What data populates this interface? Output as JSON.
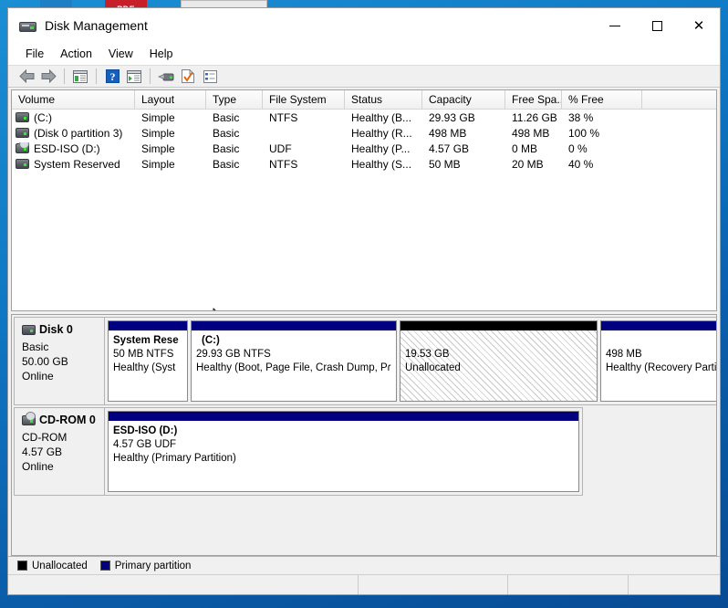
{
  "window": {
    "title": "Disk Management",
    "icon": "disk-drive-icon",
    "controls": {
      "minimize": "—",
      "maximize": "□",
      "close": "✕"
    }
  },
  "menubar": {
    "items": [
      {
        "label": "File"
      },
      {
        "label": "Action"
      },
      {
        "label": "View"
      },
      {
        "label": "Help"
      }
    ]
  },
  "toolbar": {
    "buttons": [
      {
        "name": "back-icon",
        "tip": "Back"
      },
      {
        "name": "forward-icon",
        "tip": "Forward"
      },
      {
        "name": "show-console-tree-icon",
        "tip": "Show/Hide Console Tree"
      },
      {
        "name": "help-icon",
        "tip": "Help"
      },
      {
        "name": "show-action-pane-icon",
        "tip": "Show/Hide Action Pane"
      },
      {
        "name": "rescan-disks-icon",
        "tip": "Rescan Disks"
      },
      {
        "name": "properties-icon",
        "tip": "Properties"
      },
      {
        "name": "list-view-icon",
        "tip": "List View"
      }
    ]
  },
  "volume_list": {
    "columns": [
      {
        "key": "volume",
        "label": "Volume"
      },
      {
        "key": "layout",
        "label": "Layout"
      },
      {
        "key": "type",
        "label": "Type"
      },
      {
        "key": "file_system",
        "label": "File System"
      },
      {
        "key": "status",
        "label": "Status"
      },
      {
        "key": "capacity",
        "label": "Capacity"
      },
      {
        "key": "free_space",
        "label": "Free Spa..."
      },
      {
        "key": "percent_free",
        "label": "% Free"
      },
      {
        "key": "extra",
        "label": ""
      }
    ],
    "rows": [
      {
        "icon": "hard-disk-icon",
        "volume": "(C:)",
        "layout": "Simple",
        "type": "Basic",
        "file_system": "NTFS",
        "status": "Healthy (B...",
        "capacity": "29.93 GB",
        "free_space": "11.26 GB",
        "percent_free": "38 %"
      },
      {
        "icon": "hard-disk-icon",
        "volume": "(Disk 0 partition 3)",
        "layout": "Simple",
        "type": "Basic",
        "file_system": "",
        "status": "Healthy (R...",
        "capacity": "498 MB",
        "free_space": "498 MB",
        "percent_free": "100 %"
      },
      {
        "icon": "cd-rom-icon",
        "volume": "ESD-ISO (D:)",
        "layout": "Simple",
        "type": "Basic",
        "file_system": "UDF",
        "status": "Healthy (P...",
        "capacity": "4.57 GB",
        "free_space": "0 MB",
        "percent_free": "0 %"
      },
      {
        "icon": "hard-disk-icon",
        "volume": "System Reserved",
        "layout": "Simple",
        "type": "Basic",
        "file_system": "NTFS",
        "status": "Healthy (S...",
        "capacity": "50 MB",
        "free_space": "20 MB",
        "percent_free": "40 %"
      }
    ]
  },
  "disks": [
    {
      "id": "disk-0",
      "icon": "hard-disk-icon",
      "name": "Disk 0",
      "type": "Basic",
      "size": "50.00 GB",
      "state": "Online",
      "partitions": [
        {
          "id": "part-sysres",
          "bar": "primary",
          "hatched": false,
          "label": "System Rese",
          "line2": "50 MB NTFS",
          "line3": "Healthy (Syst"
        },
        {
          "id": "part-c",
          "bar": "primary",
          "hatched": false,
          "label": "(C:)",
          "line2": "29.93 GB NTFS",
          "line3": "Healthy (Boot, Page File, Crash Dump, Pɾ"
        },
        {
          "id": "part-unalloc",
          "bar": "unalloc",
          "hatched": true,
          "label": "",
          "line2": "19.53 GB",
          "line3": "Unallocated"
        },
        {
          "id": "part-recovery",
          "bar": "primary",
          "hatched": false,
          "label": "",
          "line2": "498 MB",
          "line3": "Healthy (Recovery Parti"
        }
      ]
    },
    {
      "id": "cdrom-0",
      "icon": "cd-rom-icon",
      "name": "CD-ROM 0",
      "type": "CD-ROM",
      "size": "4.57 GB",
      "state": "Online",
      "partitions": [
        {
          "id": "part-esdiso",
          "bar": "primary",
          "hatched": false,
          "label": "ESD-ISO  (D:)",
          "line2": "4.57 GB UDF",
          "line3": "Healthy (Primary Partition)"
        }
      ]
    }
  ],
  "legend": {
    "items": [
      {
        "label": "Unallocated",
        "color": "#000000"
      },
      {
        "label": "Primary partition",
        "color": "#000080"
      }
    ]
  },
  "colors": {
    "primary_partition": "#000080",
    "unallocated": "#000000",
    "window_chrome": "#f0f0f0",
    "desktop": "#0f78c4"
  }
}
